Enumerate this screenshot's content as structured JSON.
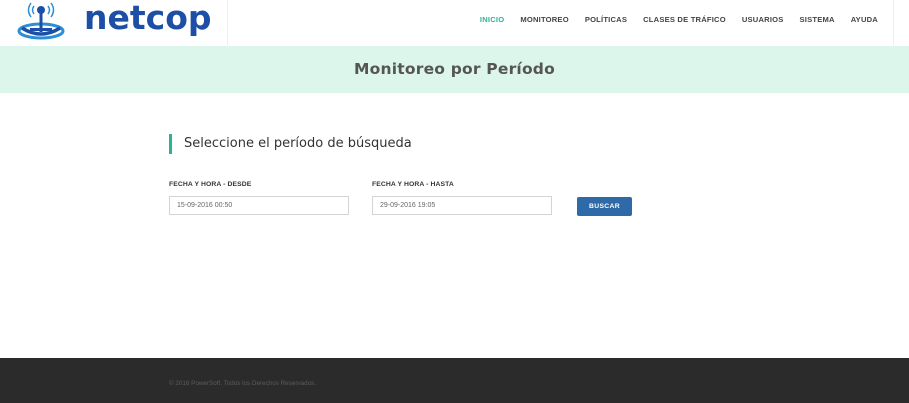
{
  "brand": {
    "name": "netcop"
  },
  "nav": {
    "items": [
      {
        "label": "INICIO",
        "active": true
      },
      {
        "label": "MONITOREO",
        "active": false
      },
      {
        "label": "POLÍTICAS",
        "active": false
      },
      {
        "label": "CLASES DE TRÁFICO",
        "active": false
      },
      {
        "label": "USUARIOS",
        "active": false
      },
      {
        "label": "SISTEMA",
        "active": false
      },
      {
        "label": "AYUDA",
        "active": false
      }
    ]
  },
  "page": {
    "title": "Monitoreo por Período"
  },
  "search": {
    "heading": "Seleccione el período de búsqueda",
    "from_label": "FECHA Y HORA - DESDE",
    "from_value": "15-09-2016 00:50",
    "to_label": "FECHA Y HORA - HASTA",
    "to_value": "29-09-2016 19:05",
    "button_label": "BUSCAR"
  },
  "footer": {
    "text": "© 2016 PowerSoft. Todos los Derechos Reservados."
  },
  "colors": {
    "accent": "#2bb39a",
    "brand": "#1d4fa6",
    "button": "#2f6aa8",
    "title_bg": "#dcf6ec",
    "footer_bg": "#2b2b2b"
  }
}
